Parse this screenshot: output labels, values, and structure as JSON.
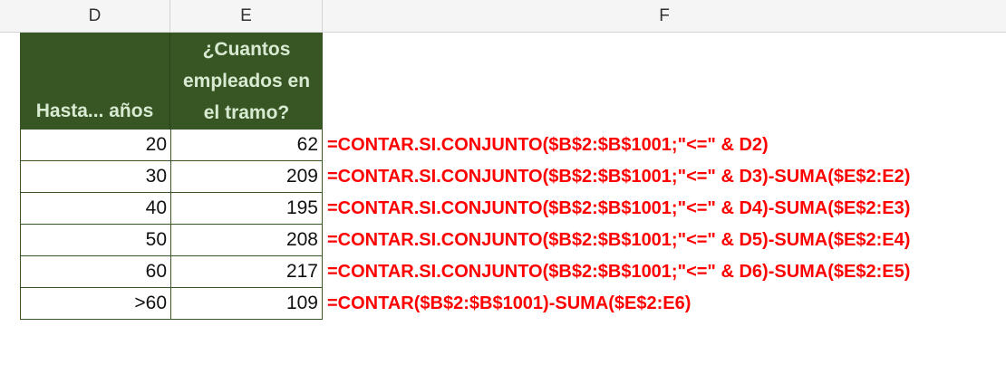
{
  "columns": {
    "d": "D",
    "e": "E",
    "f": "F"
  },
  "header": {
    "d": "Hasta... años",
    "e_lines": [
      "¿Cuantos",
      "empleados en",
      "el tramo?"
    ]
  },
  "rows": [
    {
      "d": "20",
      "e": "62",
      "formula": "=CONTAR.SI.CONJUNTO($B$2:$B$1001;\"<=\" & D2)"
    },
    {
      "d": "30",
      "e": "209",
      "formula": "=CONTAR.SI.CONJUNTO($B$2:$B$1001;\"<=\" & D3)-SUMA($E$2:E2)"
    },
    {
      "d": "40",
      "e": "195",
      "formula": "=CONTAR.SI.CONJUNTO($B$2:$B$1001;\"<=\" & D4)-SUMA($E$2:E3)"
    },
    {
      "d": "50",
      "e": "208",
      "formula": "=CONTAR.SI.CONJUNTO($B$2:$B$1001;\"<=\" & D5)-SUMA($E$2:E4)"
    },
    {
      "d": "60",
      "e": "217",
      "formula": "=CONTAR.SI.CONJUNTO($B$2:$B$1001;\"<=\" & D6)-SUMA($E$2:E5)"
    },
    {
      "d": ">60",
      "e": "109",
      "formula": "=CONTAR($B$2:$B$1001)-SUMA($E$2:E6)"
    }
  ],
  "colors": {
    "header_bg": "#375623",
    "header_text": "#d9ead3",
    "formula_text": "#ff0000"
  }
}
